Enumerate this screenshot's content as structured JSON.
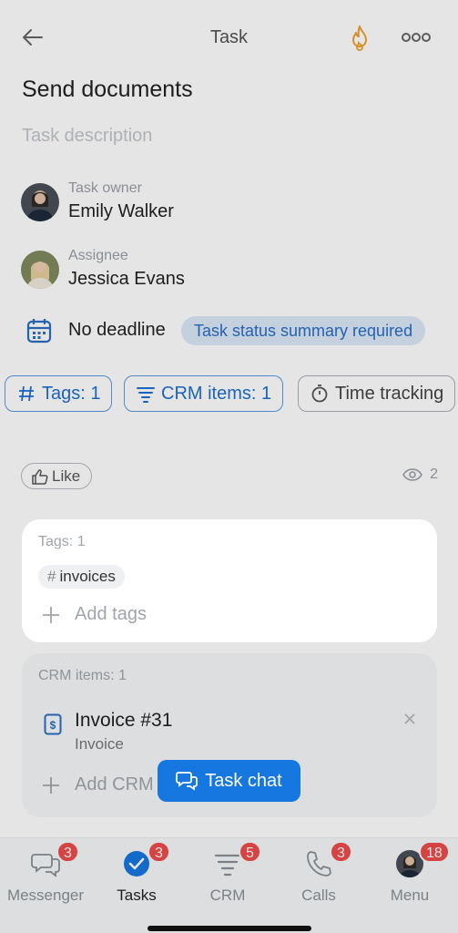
{
  "header": {
    "title": "Task"
  },
  "task": {
    "title": "Send documents",
    "description_placeholder": "Task description"
  },
  "owner": {
    "role": "Task owner",
    "name": "Emily Walker"
  },
  "assignee": {
    "role": "Assignee",
    "name": "Jessica Evans"
  },
  "deadline": {
    "text": "No deadline",
    "status_badge": "Task status summary required"
  },
  "chips": [
    {
      "label": "Tags: 1",
      "icon": "hash-icon"
    },
    {
      "label": "CRM items: 1",
      "icon": "funnel-icon"
    },
    {
      "label": "Time tracking",
      "icon": "stopwatch-icon"
    }
  ],
  "like": {
    "label": "Like",
    "views": "2"
  },
  "tags_card": {
    "title": "Tags: 1",
    "tags": [
      "invoices"
    ],
    "add_label": "Add tags"
  },
  "crm_card": {
    "title": "CRM items: 1",
    "item": {
      "name": "Invoice #31",
      "type": "Invoice"
    },
    "add_label": "Add CRM"
  },
  "chat_button": {
    "label": "Task chat"
  },
  "bottom_nav": [
    {
      "label": "Messenger",
      "badge": "3",
      "icon": "chat-bubbles-icon",
      "active": false
    },
    {
      "label": "Tasks",
      "badge": "3",
      "icon": "check-circle-icon",
      "active": true
    },
    {
      "label": "CRM",
      "badge": "5",
      "icon": "funnel-icon",
      "active": false
    },
    {
      "label": "Calls",
      "badge": "3",
      "icon": "phone-icon",
      "active": false
    },
    {
      "label": "Menu",
      "badge": "18",
      "icon": "avatar-icon",
      "active": false
    }
  ],
  "colors": {
    "accent": "#1677e0",
    "fire": "#f0a030",
    "badge": "#ee4b4b",
    "status_badge_bg": "#dbe8f6"
  }
}
